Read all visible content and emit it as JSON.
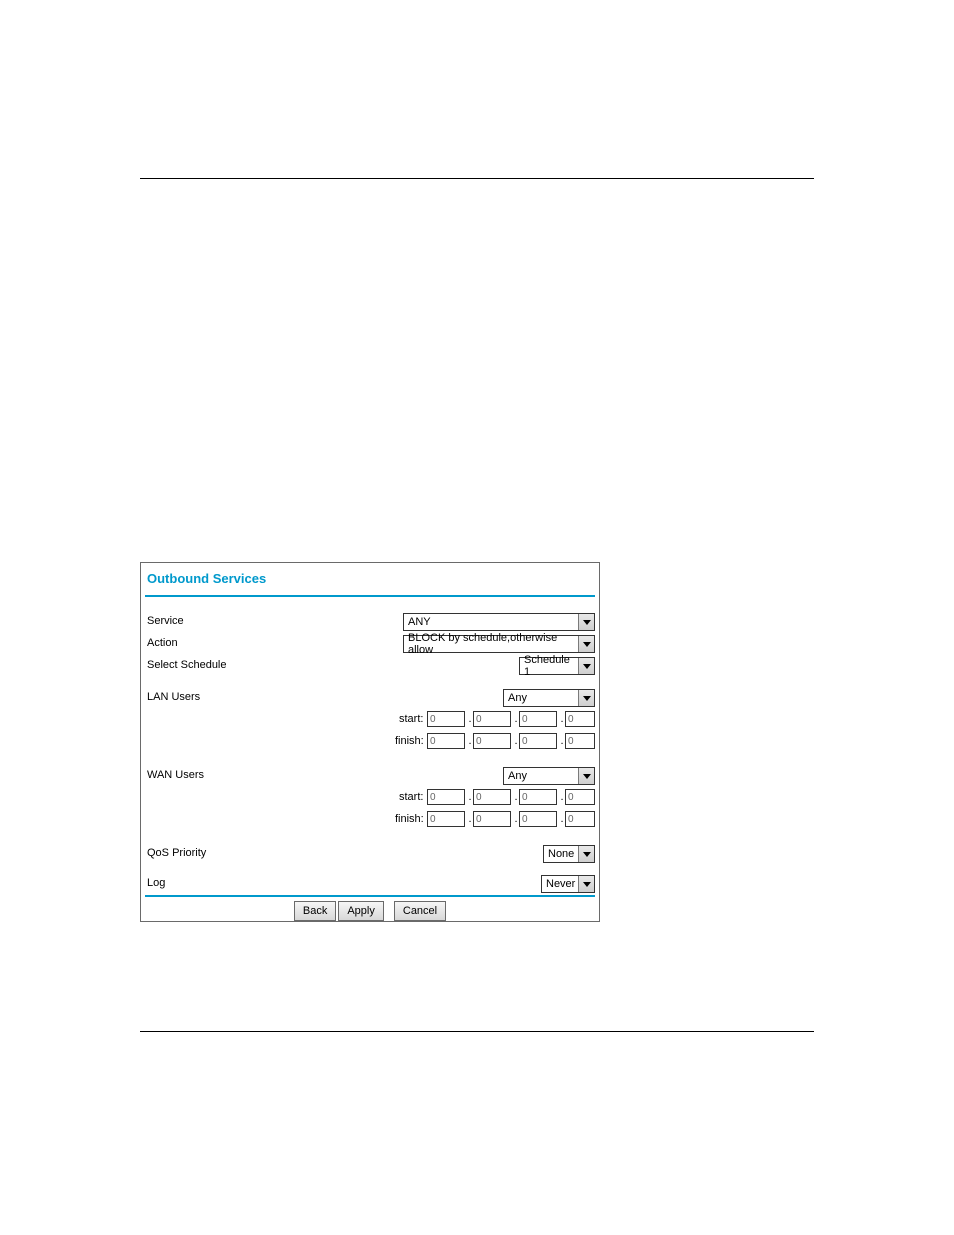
{
  "panel": {
    "title": "Outbound Services",
    "labels": {
      "service": "Service",
      "action": "Action",
      "select_schedule": "Select Schedule",
      "lan_users": "LAN Users",
      "wan_users": "WAN Users",
      "qos_priority": "QoS Priority",
      "log": "Log"
    },
    "values": {
      "service": "ANY",
      "action": "BLOCK by schedule,otherwise allow",
      "select_schedule": "Schedule 1",
      "lan_users": "Any",
      "wan_users": "Any",
      "qos_priority": "None",
      "log": "Never"
    },
    "ip": {
      "start_label": "start:",
      "finish_label": "finish:",
      "dot": ".",
      "value": "0",
      "lan_start": [
        "0",
        "0",
        "0",
        "0"
      ],
      "lan_finish": [
        "0",
        "0",
        "0",
        "0"
      ],
      "wan_start": [
        "0",
        "0",
        "0",
        "0"
      ],
      "wan_finish": [
        "0",
        "0",
        "0",
        "0"
      ]
    },
    "buttons": {
      "back": "Back",
      "apply": "Apply",
      "cancel": "Cancel"
    }
  }
}
